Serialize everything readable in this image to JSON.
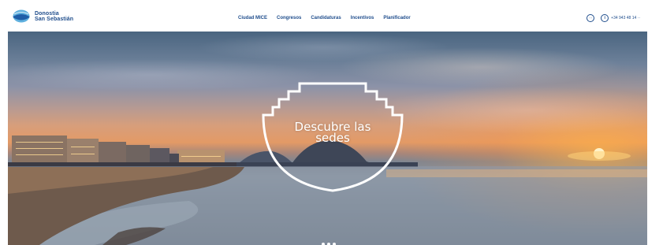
{
  "header": {
    "logo": {
      "line1": "Donostia",
      "line2": "San Sebastián"
    },
    "nav": [
      {
        "label": "Ciudad MICE"
      },
      {
        "label": "Congresos"
      },
      {
        "label": "Candidaturas"
      },
      {
        "label": "Incentivos"
      },
      {
        "label": "Planificador"
      }
    ],
    "language_icon": "globe-language-icon",
    "phone": {
      "icon": "info-circle-icon",
      "text": "+34 943 48 14 ··"
    }
  },
  "hero": {
    "cta_label_line1": "Descubre las",
    "cta_label_line2": "sedes",
    "scroll_indicator_icon": "scroll-dots-icon"
  },
  "colors": {
    "brand_blue": "#1f4d8c",
    "cta_stroke": "#ffffff"
  }
}
